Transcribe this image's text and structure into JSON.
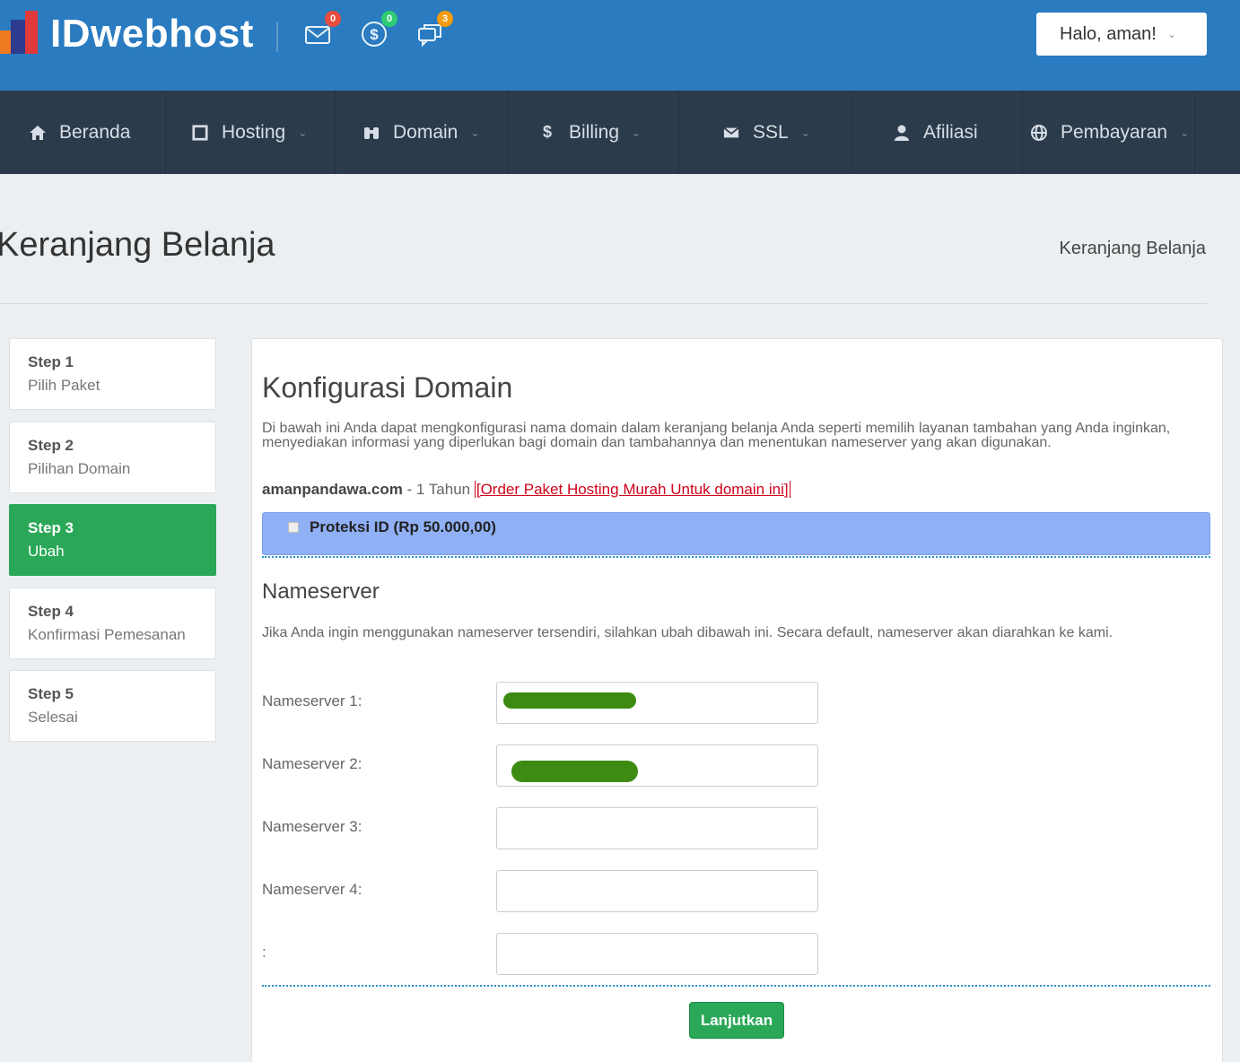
{
  "brand": {
    "name": "IDwebhost"
  },
  "header": {
    "notifications": [
      {
        "icon": "mail-icon",
        "count": "0",
        "color": "#e74c3c"
      },
      {
        "icon": "dollar-icon",
        "count": "0",
        "color": "#2ecc71"
      },
      {
        "icon": "chat-icon",
        "count": "3",
        "color": "#f39c12"
      }
    ],
    "user_greeting": "Halo, aman!"
  },
  "nav": {
    "items": [
      {
        "label": "Beranda",
        "icon": "home-icon"
      },
      {
        "label": "Hosting",
        "icon": "server-icon",
        "dropdown": true
      },
      {
        "label": "Domain",
        "icon": "binoculars-icon",
        "dropdown": true
      },
      {
        "label": "Billing",
        "icon": "dollar-icon",
        "dropdown": true
      },
      {
        "label": "SSL",
        "icon": "envelope-icon",
        "dropdown": true
      },
      {
        "label": "Afiliasi",
        "icon": "user-icon"
      },
      {
        "label": "Pembayaran",
        "icon": "globe-icon",
        "dropdown": true
      }
    ]
  },
  "page": {
    "title": "Keranjang Belanja",
    "breadcrumb": "Keranjang Belanja"
  },
  "steps": [
    {
      "title": "Step 1",
      "subtitle": "Pilih Paket"
    },
    {
      "title": "Step 2",
      "subtitle": "Pilihan Domain"
    },
    {
      "title": "Step 3",
      "subtitle": "Ubah",
      "active": true
    },
    {
      "title": "Step 4",
      "subtitle": "Konfirmasi Pemesanan"
    },
    {
      "title": "Step 5",
      "subtitle": "Selesai"
    }
  ],
  "config": {
    "heading": "Konfigurasi Domain",
    "description": "Di bawah ini Anda dapat mengkonfigurasi nama domain dalam keranjang belanja Anda seperti memilih layanan tambahan yang Anda inginkan, menyediakan informasi yang diperlukan bagi domain dan tambahannya dan menentukan nameserver yang akan digunakan.",
    "domain": "amanpandawa.com",
    "period": " - 1 Tahun ",
    "order_link": "[Order Paket Hosting Murah Untuk domain ini]",
    "addon_label": "Proteksi ID (Rp 50.000,00)",
    "addon_checked": false
  },
  "nameserver": {
    "heading": "Nameserver",
    "description": "Jika Anda ingin menggunakan nameserver tersendiri, silahkan ubah dibawah ini. Secara default, nameserver akan diarahkan ke kami.",
    "fields": [
      {
        "label": "Nameserver 1:",
        "value": ""
      },
      {
        "label": "Nameserver 2:",
        "value": ""
      },
      {
        "label": "Nameserver 3:",
        "value": ""
      },
      {
        "label": "Nameserver 4:",
        "value": ""
      },
      {
        "label": ":",
        "value": ""
      }
    ],
    "submit_label": "Lanjutkan"
  }
}
